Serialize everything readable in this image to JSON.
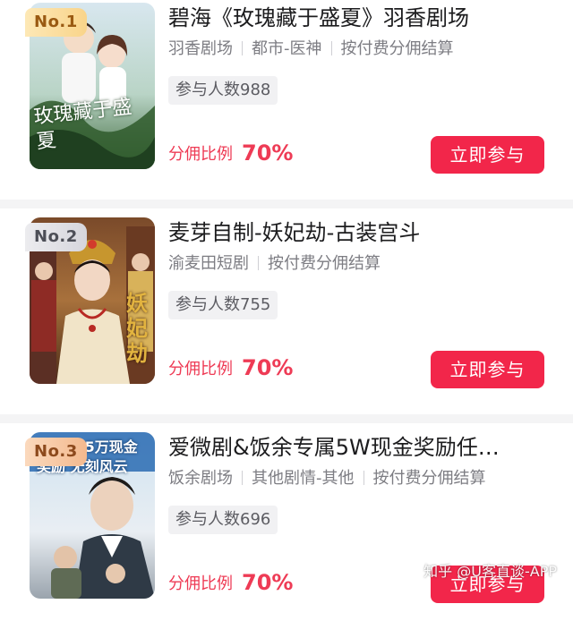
{
  "items": [
    {
      "rank": "No.1",
      "title": "碧海《玫瑰藏于盛夏》羽香剧场",
      "tags": [
        "羽香剧场",
        "都市-医神",
        "按付费分佣结算"
      ],
      "participants": "参与人数988",
      "ratio_label": "分佣比例",
      "ratio_value": "70%",
      "button": "立即参与",
      "poster_text": "玫瑰藏于盛夏"
    },
    {
      "rank": "No.2",
      "title": "麦芽自制-妖妃劫-古装宫斗",
      "tags": [
        "渝麦田短剧",
        "按付费分佣结算"
      ],
      "participants": "参与人数755",
      "ratio_label": "分佣比例",
      "ratio_value": "70%",
      "button": "立即参与",
      "poster_text": "妖妃劫"
    },
    {
      "rank": "No.3",
      "title": "爱微剧&饭余专属5W现金奖励任…",
      "tags": [
        "饭余剧场",
        "其他剧情-其他",
        "按付费分佣结算"
      ],
      "participants": "参与人数696",
      "ratio_label": "分佣比例",
      "ratio_value": "70%",
      "button": "立即参与",
      "poster_text": "爱微剧 5万现金奖励 无刻风云"
    }
  ],
  "watermark": "知乎 @U客直谈-APP",
  "colors": {
    "accent": "#f2264a",
    "ratio_text": "#ee3b55",
    "title_text": "#1c1c1e",
    "tag_text": "#7d7d83"
  },
  "icons": [
    "rank-gold-badge",
    "rank-silver-badge",
    "rank-bronze-badge"
  ]
}
